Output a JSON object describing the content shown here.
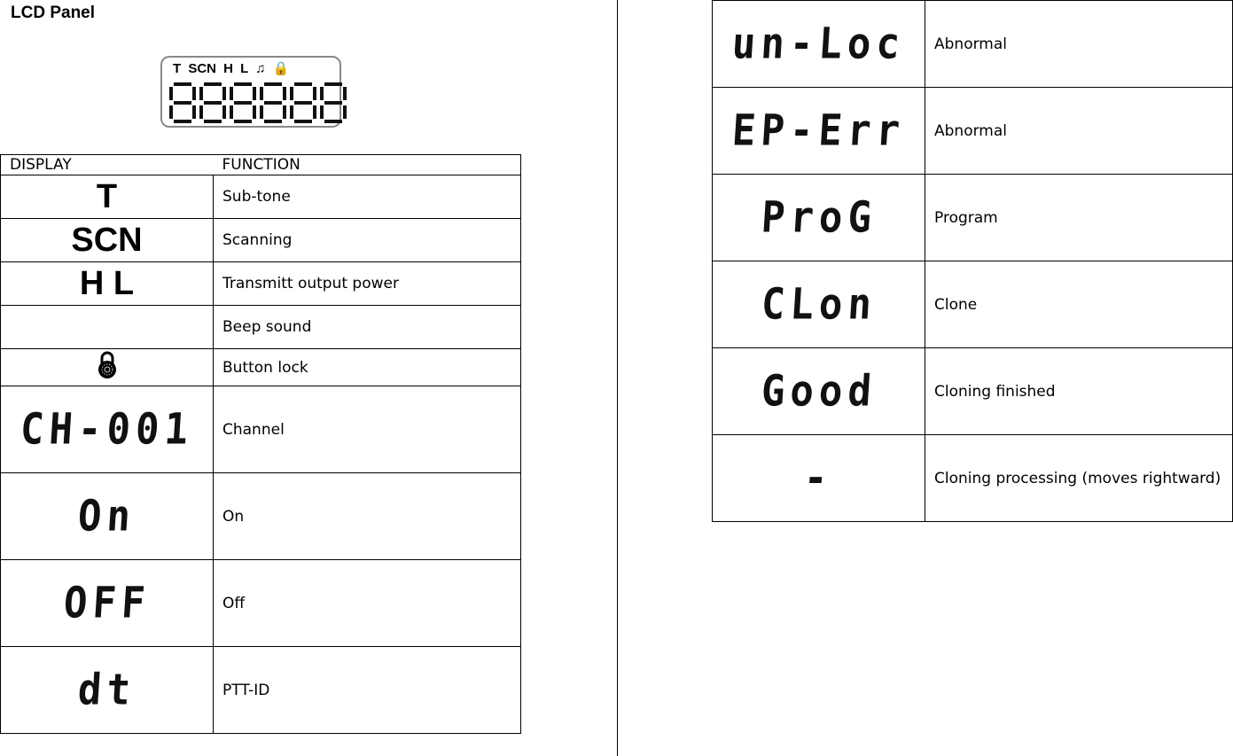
{
  "title": "LCD Panel",
  "lcd_image": {
    "icons": "T SCN H L ♫ 🔒",
    "digits": "888888"
  },
  "left_table": {
    "headers": [
      "DISPLAY",
      "FUNCTION"
    ],
    "rows": [
      {
        "display": "T",
        "kind": "text",
        "function": "Sub-tone"
      },
      {
        "display": "SCN",
        "kind": "text",
        "function": "Scanning"
      },
      {
        "display": "H  L",
        "kind": "text",
        "function": "Transmitt output power"
      },
      {
        "display": "",
        "kind": "empty",
        "function": "Beep sound"
      },
      {
        "display": "lock-icon",
        "kind": "icon",
        "function": "Button lock"
      },
      {
        "display": "CH-001",
        "kind": "seg",
        "function": "Channel"
      },
      {
        "display": "On",
        "kind": "seg",
        "function": "On"
      },
      {
        "display": "OFF",
        "kind": "seg",
        "function": "Off"
      },
      {
        "display": "dt",
        "kind": "seg",
        "function": "PTT-ID"
      }
    ]
  },
  "right_table": {
    "rows": [
      {
        "display": "un-Loc",
        "function": "Abnormal"
      },
      {
        "display": "EP-Err",
        "function": "Abnormal"
      },
      {
        "display": "ProG",
        "function": "Program"
      },
      {
        "display": "CLon",
        "function": "Clone"
      },
      {
        "display": "Good",
        "function": "Cloning finished"
      },
      {
        "display": "-",
        "function": "Cloning processing (moves rightward)"
      }
    ]
  }
}
